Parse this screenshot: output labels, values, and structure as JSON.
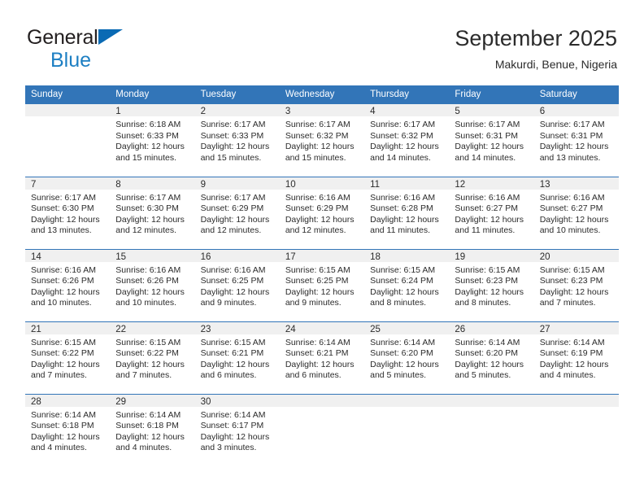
{
  "brand": {
    "word1": "General",
    "word2": "Blue",
    "triangle_color": "#0a6ab4",
    "word2_color": "#1d7fc3"
  },
  "header": {
    "title": "September 2025",
    "subtitle": "Makurdi, Benue, Nigeria"
  },
  "theme": {
    "header_bar": "#3275b8",
    "daynum_strip": "#f0f0f0",
    "text": "#2b2b2b"
  },
  "weekday_headers": [
    "Sunday",
    "Monday",
    "Tuesday",
    "Wednesday",
    "Thursday",
    "Friday",
    "Saturday"
  ],
  "weeks": [
    [
      {
        "day": "",
        "sunrise": "",
        "sunset": "",
        "daylight_a": "",
        "daylight_b": ""
      },
      {
        "day": "1",
        "sunrise": "Sunrise: 6:18 AM",
        "sunset": "Sunset: 6:33 PM",
        "daylight_a": "Daylight: 12 hours",
        "daylight_b": "and 15 minutes."
      },
      {
        "day": "2",
        "sunrise": "Sunrise: 6:17 AM",
        "sunset": "Sunset: 6:33 PM",
        "daylight_a": "Daylight: 12 hours",
        "daylight_b": "and 15 minutes."
      },
      {
        "day": "3",
        "sunrise": "Sunrise: 6:17 AM",
        "sunset": "Sunset: 6:32 PM",
        "daylight_a": "Daylight: 12 hours",
        "daylight_b": "and 15 minutes."
      },
      {
        "day": "4",
        "sunrise": "Sunrise: 6:17 AM",
        "sunset": "Sunset: 6:32 PM",
        "daylight_a": "Daylight: 12 hours",
        "daylight_b": "and 14 minutes."
      },
      {
        "day": "5",
        "sunrise": "Sunrise: 6:17 AM",
        "sunset": "Sunset: 6:31 PM",
        "daylight_a": "Daylight: 12 hours",
        "daylight_b": "and 14 minutes."
      },
      {
        "day": "6",
        "sunrise": "Sunrise: 6:17 AM",
        "sunset": "Sunset: 6:31 PM",
        "daylight_a": "Daylight: 12 hours",
        "daylight_b": "and 13 minutes."
      }
    ],
    [
      {
        "day": "7",
        "sunrise": "Sunrise: 6:17 AM",
        "sunset": "Sunset: 6:30 PM",
        "daylight_a": "Daylight: 12 hours",
        "daylight_b": "and 13 minutes."
      },
      {
        "day": "8",
        "sunrise": "Sunrise: 6:17 AM",
        "sunset": "Sunset: 6:30 PM",
        "daylight_a": "Daylight: 12 hours",
        "daylight_b": "and 12 minutes."
      },
      {
        "day": "9",
        "sunrise": "Sunrise: 6:17 AM",
        "sunset": "Sunset: 6:29 PM",
        "daylight_a": "Daylight: 12 hours",
        "daylight_b": "and 12 minutes."
      },
      {
        "day": "10",
        "sunrise": "Sunrise: 6:16 AM",
        "sunset": "Sunset: 6:29 PM",
        "daylight_a": "Daylight: 12 hours",
        "daylight_b": "and 12 minutes."
      },
      {
        "day": "11",
        "sunrise": "Sunrise: 6:16 AM",
        "sunset": "Sunset: 6:28 PM",
        "daylight_a": "Daylight: 12 hours",
        "daylight_b": "and 11 minutes."
      },
      {
        "day": "12",
        "sunrise": "Sunrise: 6:16 AM",
        "sunset": "Sunset: 6:27 PM",
        "daylight_a": "Daylight: 12 hours",
        "daylight_b": "and 11 minutes."
      },
      {
        "day": "13",
        "sunrise": "Sunrise: 6:16 AM",
        "sunset": "Sunset: 6:27 PM",
        "daylight_a": "Daylight: 12 hours",
        "daylight_b": "and 10 minutes."
      }
    ],
    [
      {
        "day": "14",
        "sunrise": "Sunrise: 6:16 AM",
        "sunset": "Sunset: 6:26 PM",
        "daylight_a": "Daylight: 12 hours",
        "daylight_b": "and 10 minutes."
      },
      {
        "day": "15",
        "sunrise": "Sunrise: 6:16 AM",
        "sunset": "Sunset: 6:26 PM",
        "daylight_a": "Daylight: 12 hours",
        "daylight_b": "and 10 minutes."
      },
      {
        "day": "16",
        "sunrise": "Sunrise: 6:16 AM",
        "sunset": "Sunset: 6:25 PM",
        "daylight_a": "Daylight: 12 hours",
        "daylight_b": "and 9 minutes."
      },
      {
        "day": "17",
        "sunrise": "Sunrise: 6:15 AM",
        "sunset": "Sunset: 6:25 PM",
        "daylight_a": "Daylight: 12 hours",
        "daylight_b": "and 9 minutes."
      },
      {
        "day": "18",
        "sunrise": "Sunrise: 6:15 AM",
        "sunset": "Sunset: 6:24 PM",
        "daylight_a": "Daylight: 12 hours",
        "daylight_b": "and 8 minutes."
      },
      {
        "day": "19",
        "sunrise": "Sunrise: 6:15 AM",
        "sunset": "Sunset: 6:23 PM",
        "daylight_a": "Daylight: 12 hours",
        "daylight_b": "and 8 minutes."
      },
      {
        "day": "20",
        "sunrise": "Sunrise: 6:15 AM",
        "sunset": "Sunset: 6:23 PM",
        "daylight_a": "Daylight: 12 hours",
        "daylight_b": "and 7 minutes."
      }
    ],
    [
      {
        "day": "21",
        "sunrise": "Sunrise: 6:15 AM",
        "sunset": "Sunset: 6:22 PM",
        "daylight_a": "Daylight: 12 hours",
        "daylight_b": "and 7 minutes."
      },
      {
        "day": "22",
        "sunrise": "Sunrise: 6:15 AM",
        "sunset": "Sunset: 6:22 PM",
        "daylight_a": "Daylight: 12 hours",
        "daylight_b": "and 7 minutes."
      },
      {
        "day": "23",
        "sunrise": "Sunrise: 6:15 AM",
        "sunset": "Sunset: 6:21 PM",
        "daylight_a": "Daylight: 12 hours",
        "daylight_b": "and 6 minutes."
      },
      {
        "day": "24",
        "sunrise": "Sunrise: 6:14 AM",
        "sunset": "Sunset: 6:21 PM",
        "daylight_a": "Daylight: 12 hours",
        "daylight_b": "and 6 minutes."
      },
      {
        "day": "25",
        "sunrise": "Sunrise: 6:14 AM",
        "sunset": "Sunset: 6:20 PM",
        "daylight_a": "Daylight: 12 hours",
        "daylight_b": "and 5 minutes."
      },
      {
        "day": "26",
        "sunrise": "Sunrise: 6:14 AM",
        "sunset": "Sunset: 6:20 PM",
        "daylight_a": "Daylight: 12 hours",
        "daylight_b": "and 5 minutes."
      },
      {
        "day": "27",
        "sunrise": "Sunrise: 6:14 AM",
        "sunset": "Sunset: 6:19 PM",
        "daylight_a": "Daylight: 12 hours",
        "daylight_b": "and 4 minutes."
      }
    ],
    [
      {
        "day": "28",
        "sunrise": "Sunrise: 6:14 AM",
        "sunset": "Sunset: 6:18 PM",
        "daylight_a": "Daylight: 12 hours",
        "daylight_b": "and 4 minutes."
      },
      {
        "day": "29",
        "sunrise": "Sunrise: 6:14 AM",
        "sunset": "Sunset: 6:18 PM",
        "daylight_a": "Daylight: 12 hours",
        "daylight_b": "and 4 minutes."
      },
      {
        "day": "30",
        "sunrise": "Sunrise: 6:14 AM",
        "sunset": "Sunset: 6:17 PM",
        "daylight_a": "Daylight: 12 hours",
        "daylight_b": "and 3 minutes."
      },
      {
        "day": "",
        "sunrise": "",
        "sunset": "",
        "daylight_a": "",
        "daylight_b": ""
      },
      {
        "day": "",
        "sunrise": "",
        "sunset": "",
        "daylight_a": "",
        "daylight_b": ""
      },
      {
        "day": "",
        "sunrise": "",
        "sunset": "",
        "daylight_a": "",
        "daylight_b": ""
      },
      {
        "day": "",
        "sunrise": "",
        "sunset": "",
        "daylight_a": "",
        "daylight_b": ""
      }
    ]
  ]
}
